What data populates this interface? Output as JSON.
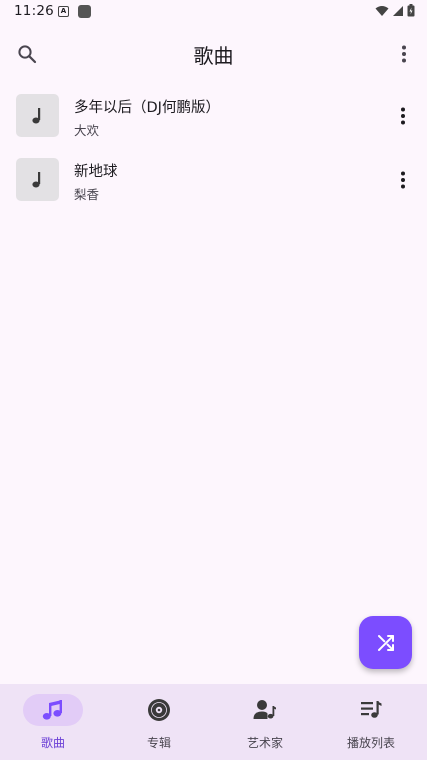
{
  "status_bar": {
    "time": "11:26",
    "notification_icons": [
      "a-icon",
      "square-icon"
    ],
    "system_icons": [
      "wifi-icon",
      "signal-icon",
      "battery-icon"
    ]
  },
  "header": {
    "title": "歌曲",
    "search_icon": "search-icon",
    "more_icon": "more-vert-icon"
  },
  "songs": [
    {
      "title": "多年以后（DJ何鹏版）",
      "artist": "大欢"
    },
    {
      "title": "新地球",
      "artist": "梨香"
    }
  ],
  "fab": {
    "icon": "shuffle-icon"
  },
  "bottom_nav": {
    "items": [
      {
        "label": "歌曲",
        "icon": "music-note-icon",
        "active": true
      },
      {
        "label": "专辑",
        "icon": "album-icon",
        "active": false
      },
      {
        "label": "艺术家",
        "icon": "artist-icon",
        "active": false
      },
      {
        "label": "播放列表",
        "icon": "playlist-icon",
        "active": false
      }
    ]
  },
  "colors": {
    "background": "#fdf6fd",
    "accent": "#7c4dff",
    "nav_background": "#efe3f6",
    "nav_active_pill": "#e2ccf7",
    "nav_active_text": "#6b3fd6",
    "thumb_background": "#e3e1e4"
  }
}
